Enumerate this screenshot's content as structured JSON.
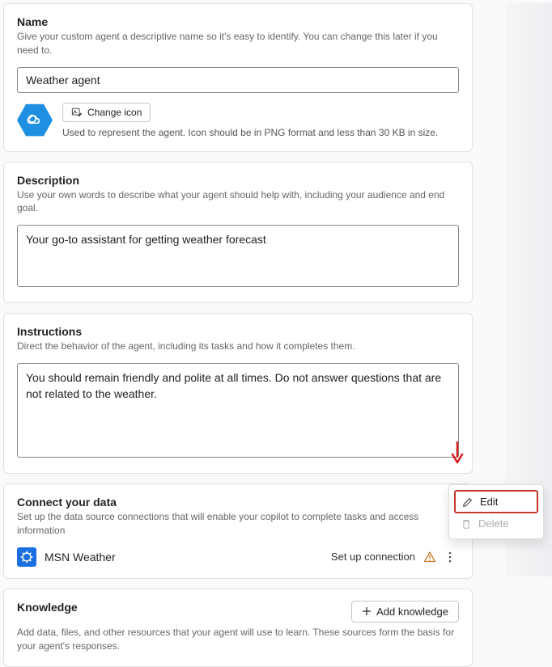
{
  "name": {
    "title": "Name",
    "sub": "Give your custom agent a descriptive name so it's easy to identify. You can change this later if you need to.",
    "value": "Weather agent",
    "change_icon_label": "Change icon",
    "icon_desc": "Used to represent the agent. Icon should be in PNG format and less than 30 KB in size."
  },
  "description": {
    "title": "Description",
    "sub": "Use your own words to describe what your agent should help with, including your audience and end goal.",
    "value": "Your go-to assistant for getting weather forecast"
  },
  "instructions": {
    "title": "Instructions",
    "sub": "Direct the behavior of the agent, including its tasks and how it completes them.",
    "value": "You should remain friendly and polite at all times. Do not answer questions that are not related to the weather."
  },
  "connect": {
    "title": "Connect your data",
    "sub": "Set up the data source connections that will enable your copilot to complete tasks and access information",
    "connector_name": "MSN Weather",
    "setup_label": "Set up connection"
  },
  "knowledge": {
    "title": "Knowledge",
    "sub": "Add data, files, and other resources that your agent will use to learn. These sources form the basis for your agent's responses.",
    "add_label": "Add knowledge"
  },
  "menu": {
    "edit": "Edit",
    "delete": "Delete"
  }
}
